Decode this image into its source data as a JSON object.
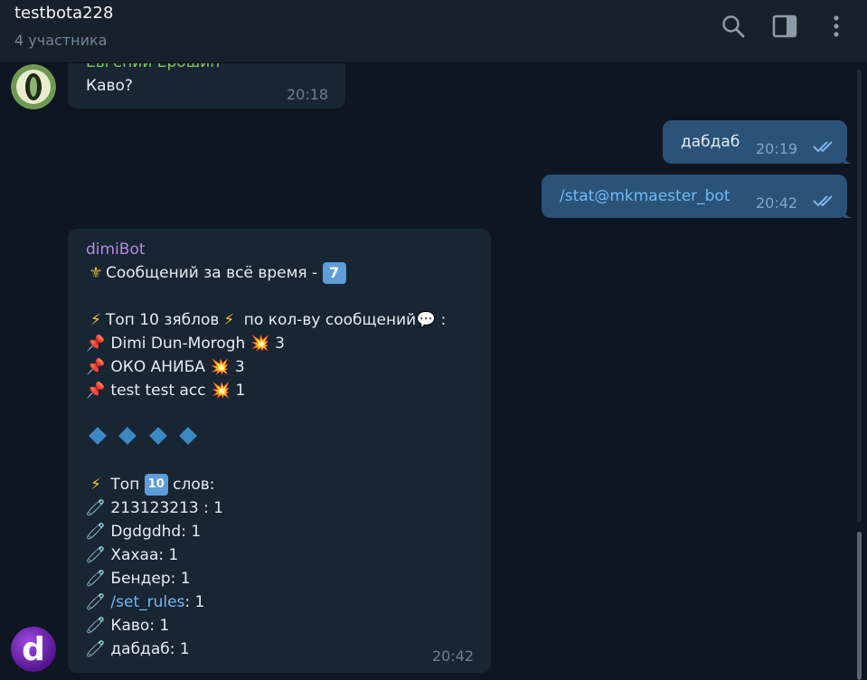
{
  "header": {
    "title": "testbota228",
    "subtitle": "4 участника"
  },
  "messages": {
    "m1": {
      "sender": "Евгений Ерошин",
      "text": "Каво?",
      "time": "20:18"
    },
    "m2": {
      "text": "дабдаб",
      "time": "20:19"
    },
    "m3": {
      "text": "/stat@mkmaester_bot",
      "time": "20:42"
    },
    "bot": {
      "sender": "dimiBot",
      "time": "20:42",
      "line1": "Сообщений за всё время - ",
      "line1_icon": "fleur-de-lis",
      "line1_badge": "7",
      "top_users_title": "Топ 10 зяблов",
      "top_users_mid": "по кол-ву сообщений",
      "top_users_end": ":",
      "users": [
        {
          "name": "Dimi Dun-Morogh",
          "count": "3"
        },
        {
          "name": "ОКО АНИБА",
          "count": "3"
        },
        {
          "name": "test test acc",
          "count": "1"
        }
      ],
      "top_words_title": "Топ",
      "top_words_badge": "10",
      "top_words_end": "слов:",
      "words": [
        {
          "word": "213123213",
          "count": ": 1"
        },
        {
          "word": "Dgdgdhd",
          "count": ": 1"
        },
        {
          "word": "Хахаа",
          "count": ": 1"
        },
        {
          "word": "Бендер",
          "count": ": 1"
        },
        {
          "word": "/set_rules",
          "count": ": 1"
        },
        {
          "word": "Каво",
          "count": ": 1"
        },
        {
          "word": "дабдаб",
          "count": ": 1"
        }
      ]
    }
  },
  "colors": {
    "background": "#0e1621",
    "header": "#17212b",
    "incoming": "#182533",
    "outgoing": "#2b5278",
    "link": "#71baf8",
    "sender_green": "#7bc862",
    "sender_purple": "#b588e5"
  }
}
